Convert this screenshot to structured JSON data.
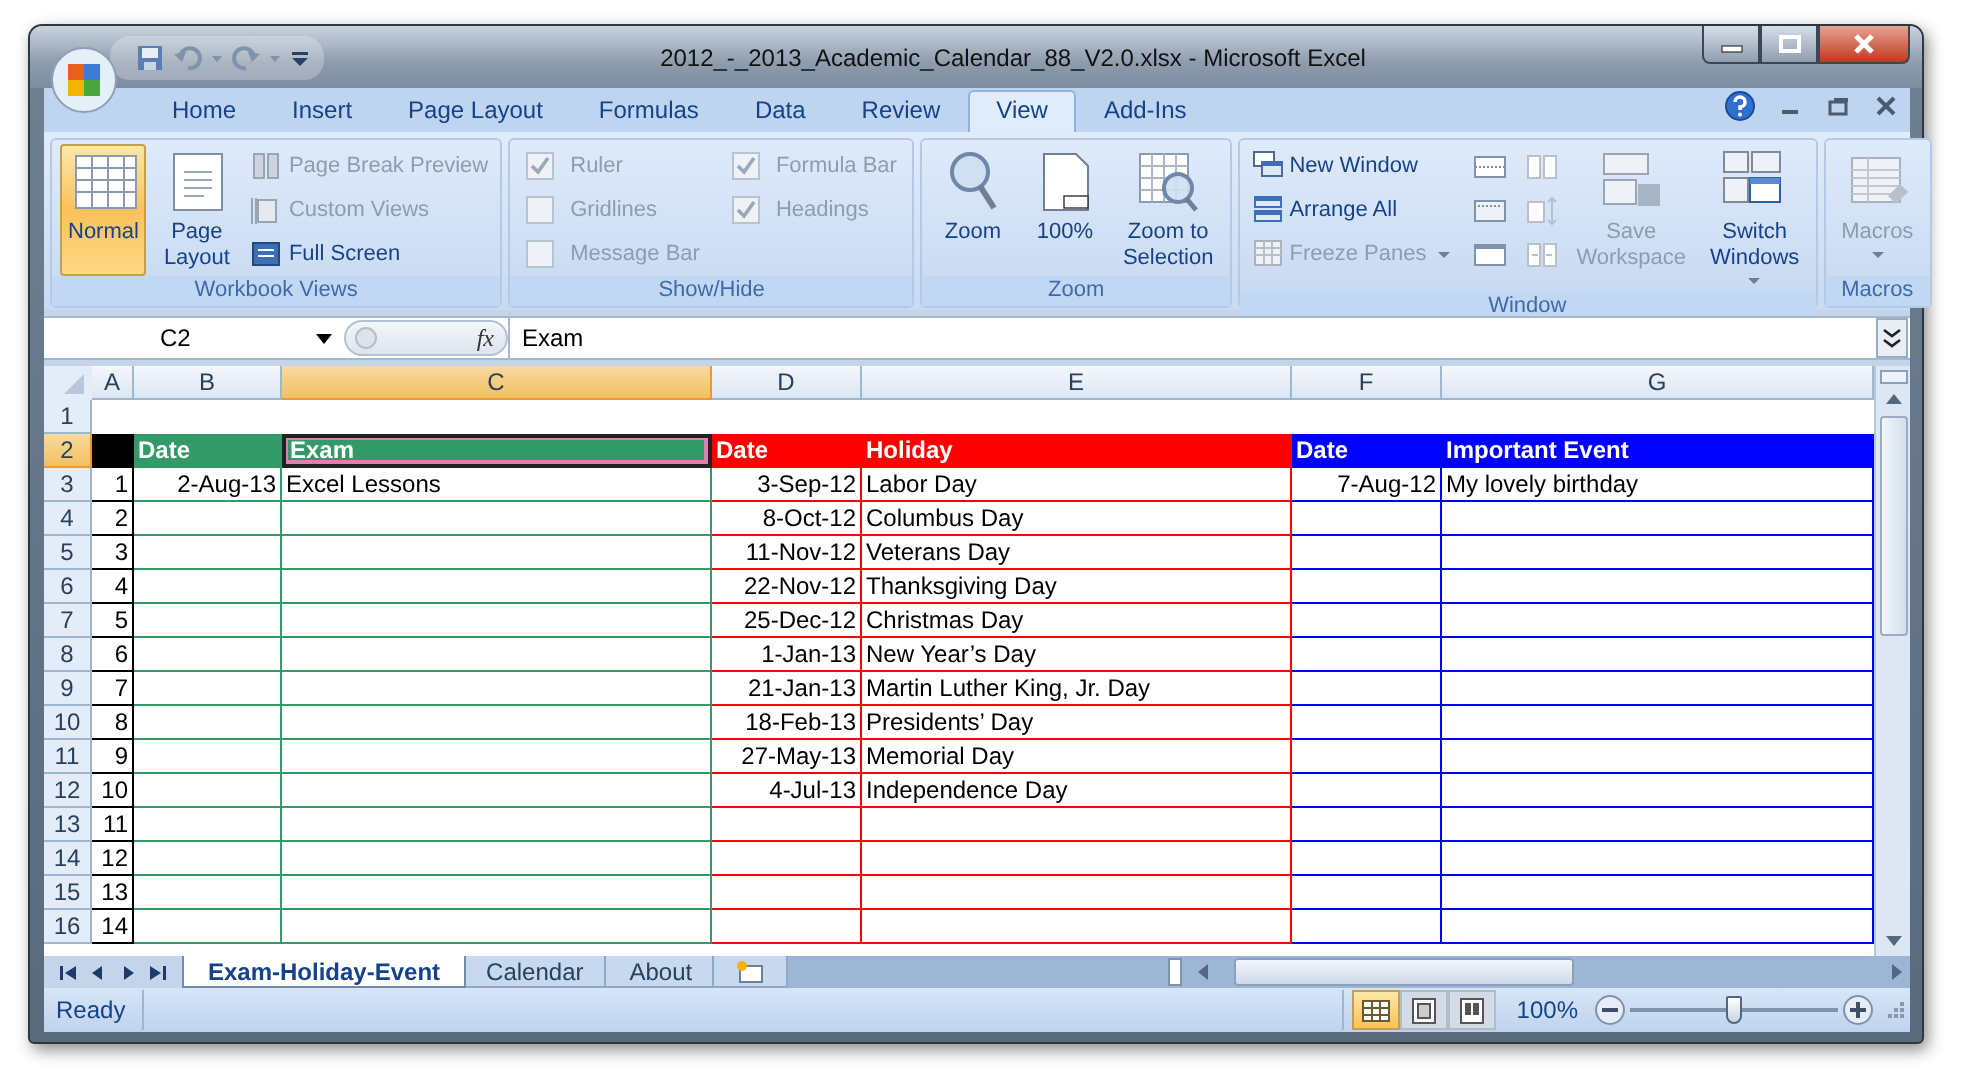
{
  "window": {
    "title": "2012_-_2013_Academic_Calendar_88_V2.0.xlsx - Microsoft Excel"
  },
  "tabs": [
    {
      "label": "Home",
      "selected": false
    },
    {
      "label": "Insert",
      "selected": false
    },
    {
      "label": "Page Layout",
      "selected": false
    },
    {
      "label": "Formulas",
      "selected": false
    },
    {
      "label": "Data",
      "selected": false
    },
    {
      "label": "Review",
      "selected": false
    },
    {
      "label": "View",
      "selected": true
    },
    {
      "label": "Add-Ins",
      "selected": false
    }
  ],
  "ribbon": [
    {
      "label": "Workbook Views",
      "items": [
        {
          "kind": "large",
          "label": "Normal",
          "selected": true,
          "disabled": false
        },
        {
          "kind": "large",
          "label": "Page Layout",
          "selected": false,
          "disabled": false
        },
        {
          "kind": "small",
          "label": "Page Break Preview",
          "disabled": true
        },
        {
          "kind": "small",
          "label": "Custom Views",
          "disabled": true
        },
        {
          "kind": "small",
          "label": "Full Screen",
          "disabled": false
        }
      ]
    },
    {
      "label": "Show/Hide",
      "items": [
        {
          "kind": "check",
          "label": "Ruler",
          "checked": true,
          "disabled": true
        },
        {
          "kind": "check",
          "label": "Gridlines",
          "checked": false,
          "disabled": true
        },
        {
          "kind": "check",
          "label": "Message Bar",
          "checked": false,
          "disabled": true
        },
        {
          "kind": "check",
          "label": "Formula Bar",
          "checked": true,
          "disabled": true
        },
        {
          "kind": "check",
          "label": "Headings",
          "checked": true,
          "disabled": true
        }
      ]
    },
    {
      "label": "Zoom",
      "items": [
        {
          "kind": "large",
          "label": "Zoom",
          "disabled": false
        },
        {
          "kind": "large",
          "label": "100%",
          "disabled": false
        },
        {
          "kind": "large",
          "label": "Zoom to Selection",
          "disabled": false
        }
      ]
    },
    {
      "label": "Window",
      "items": [
        {
          "kind": "small",
          "label": "New Window",
          "disabled": false
        },
        {
          "kind": "small",
          "label": "Arrange All",
          "disabled": false
        },
        {
          "kind": "small",
          "label": "Freeze Panes",
          "disabled": true,
          "dropdown": true
        },
        {
          "kind": "icon",
          "disabled": false
        },
        {
          "kind": "icon",
          "disabled": false
        },
        {
          "kind": "icon",
          "disabled": false
        },
        {
          "kind": "icon",
          "disabled": true
        },
        {
          "kind": "icon",
          "disabled": true
        },
        {
          "kind": "icon",
          "disabled": true
        },
        {
          "kind": "large",
          "label": "Save Workspace",
          "disabled": true
        },
        {
          "kind": "large",
          "label": "Switch Windows",
          "disabled": false,
          "dropdown": true
        }
      ]
    },
    {
      "label": "Macros",
      "items": [
        {
          "kind": "large",
          "label": "Macros",
          "disabled": true,
          "dropdown": true
        }
      ]
    }
  ],
  "formula_bar": {
    "name_box": "C2",
    "function_label": "fx",
    "formula": "Exam"
  },
  "sheet": {
    "columns": [
      {
        "label": "A",
        "color": "#000000",
        "kind": "number",
        "selected": false
      },
      {
        "label": "B",
        "color": "#339966",
        "kind": "number",
        "selected": false
      },
      {
        "label": "C",
        "color": "#339966",
        "kind": "text",
        "selected": true
      },
      {
        "label": "D",
        "color": "#ff0000",
        "kind": "number",
        "selected": false
      },
      {
        "label": "E",
        "color": "#ff0000",
        "kind": "text",
        "selected": false
      },
      {
        "label": "F",
        "color": "#0000ff",
        "kind": "number",
        "selected": false
      },
      {
        "label": "G",
        "color": "#0000ff",
        "kind": "text",
        "selected": false
      }
    ],
    "rows": [
      {
        "label": "1",
        "kind": "blank",
        "selected": false
      },
      {
        "label": "2",
        "kind": "header",
        "selected": true,
        "cells": [
          null,
          "Date",
          "Exam",
          "Date",
          "Holiday",
          "Date",
          "Important Event"
        ]
      },
      {
        "label": "3",
        "kind": "data",
        "selected": false,
        "cells": [
          "1",
          "2-Aug-13",
          "Excel Lessons",
          "3-Sep-12",
          "Labor Day",
          "7-Aug-12",
          "My lovely birthday"
        ]
      },
      {
        "label": "4",
        "kind": "data",
        "selected": false,
        "cells": [
          "2",
          null,
          null,
          "8-Oct-12",
          "Columbus Day",
          null,
          null
        ]
      },
      {
        "label": "5",
        "kind": "data",
        "selected": false,
        "cells": [
          "3",
          null,
          null,
          "11-Nov-12",
          "Veterans Day",
          null,
          null
        ]
      },
      {
        "label": "6",
        "kind": "data",
        "selected": false,
        "cells": [
          "4",
          null,
          null,
          "22-Nov-12",
          "Thanksgiving Day",
          null,
          null
        ]
      },
      {
        "label": "7",
        "kind": "data",
        "selected": false,
        "cells": [
          "5",
          null,
          null,
          "25-Dec-12",
          "Christmas Day",
          null,
          null
        ]
      },
      {
        "label": "8",
        "kind": "data",
        "selected": false,
        "cells": [
          "6",
          null,
          null,
          "1-Jan-13",
          "New Year’s Day",
          null,
          null
        ]
      },
      {
        "label": "9",
        "kind": "data",
        "selected": false,
        "cells": [
          "7",
          null,
          null,
          "21-Jan-13",
          "Martin Luther King, Jr. Day",
          null,
          null
        ]
      },
      {
        "label": "10",
        "kind": "data",
        "selected": false,
        "cells": [
          "8",
          null,
          null,
          "18-Feb-13",
          "Presidents’ Day",
          null,
          null
        ]
      },
      {
        "label": "11",
        "kind": "data",
        "selected": false,
        "cells": [
          "9",
          null,
          null,
          "27-May-13",
          "Memorial Day",
          null,
          null
        ]
      },
      {
        "label": "12",
        "kind": "data",
        "selected": false,
        "cells": [
          "10",
          null,
          null,
          "4-Jul-13",
          "Independence Day",
          null,
          null
        ]
      },
      {
        "label": "13",
        "kind": "data",
        "selected": false,
        "cells": [
          "11",
          null,
          null,
          null,
          null,
          null,
          null
        ]
      },
      {
        "label": "14",
        "kind": "data",
        "selected": false,
        "cells": [
          "12",
          null,
          null,
          null,
          null,
          null,
          null
        ]
      },
      {
        "label": "15",
        "kind": "data",
        "selected": false,
        "cells": [
          "13",
          null,
          null,
          null,
          null,
          null,
          null
        ]
      },
      {
        "label": "16",
        "kind": "data",
        "selected": false,
        "cells": [
          "14",
          null,
          null,
          null,
          null,
          null,
          null
        ]
      }
    ]
  },
  "sheet_tabs": [
    {
      "label": "Exam-Holiday-Event",
      "selected": true
    },
    {
      "label": "Calendar",
      "selected": false
    },
    {
      "label": "About",
      "selected": false
    }
  ],
  "status_bar": {
    "status": "Ready",
    "views": [
      {
        "selected": true
      },
      {
        "selected": false
      },
      {
        "selected": false
      }
    ],
    "zoom": "100%",
    "level": 0.5
  }
}
